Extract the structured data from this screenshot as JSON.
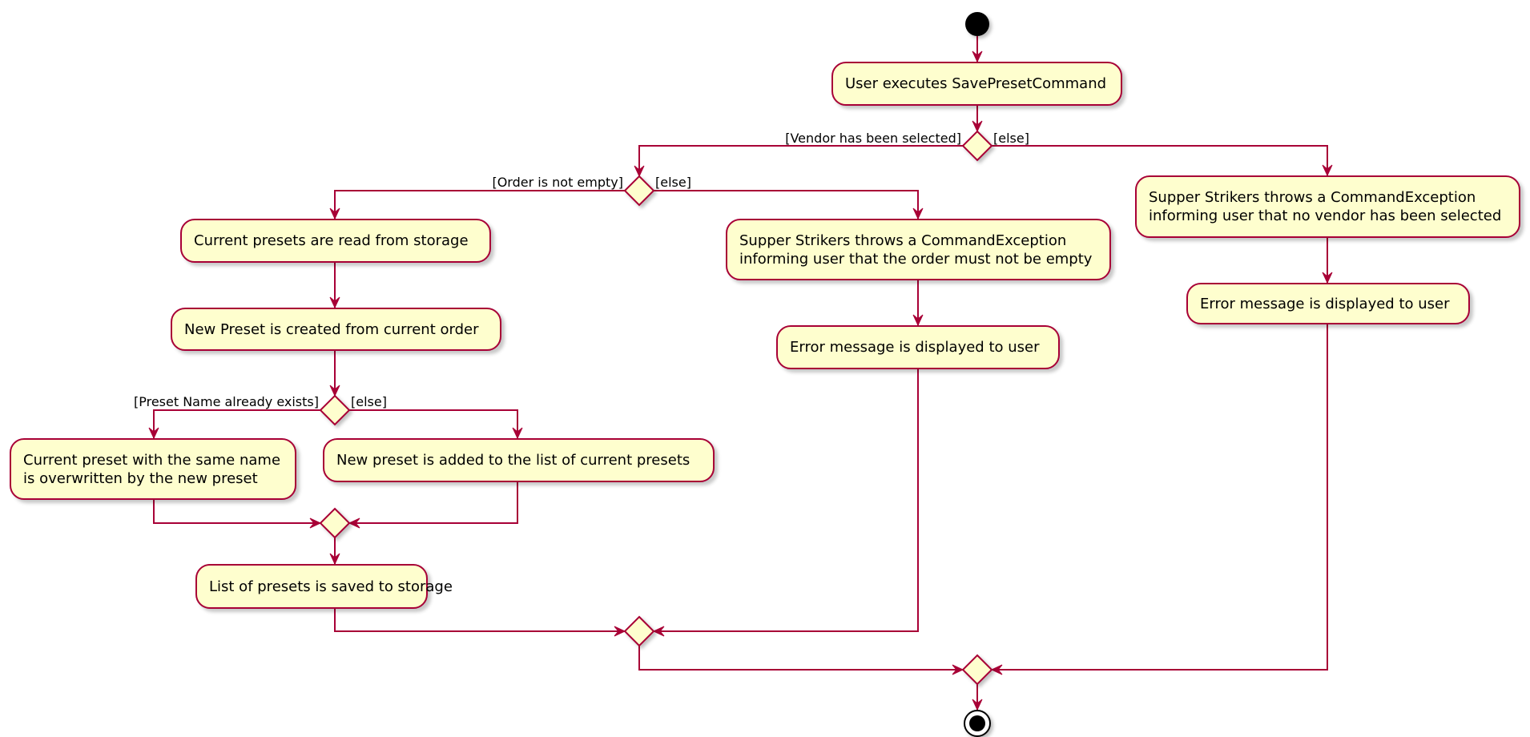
{
  "diagram": {
    "type": "UML activity diagram",
    "colors": {
      "border": "#A80036",
      "fill": "#FEFECE",
      "arrow": "#A80036",
      "node_start": "#000000"
    },
    "start": "start-node",
    "end": "end-node",
    "activities": {
      "user_executes": "User executes SavePresetCommand",
      "read_presets": "Current presets are read from storage",
      "create_preset": "New Preset is created from current order",
      "overwrite_preset": "Current preset with the same name\nis overwritten by the new preset",
      "add_preset": "New preset is added to the list of current presets",
      "save_presets": "List of presets is saved to storage",
      "throw_order_empty": "Supper Strikers throws a CommandException\ninforming user that the order must not be empty",
      "error_mid": "Error message is displayed to user",
      "throw_no_vendor": "Supper Strikers throws a CommandException\ninforming user that no vendor has been selected",
      "error_right": "Error message is displayed to user"
    },
    "guards": {
      "vendor_selected": "[Vendor has been selected]",
      "vendor_else": "[else]",
      "order_not_empty": "[Order is not empty]",
      "order_else": "[else]",
      "name_exists": "[Preset Name already exists]",
      "name_else": "[else]"
    }
  }
}
